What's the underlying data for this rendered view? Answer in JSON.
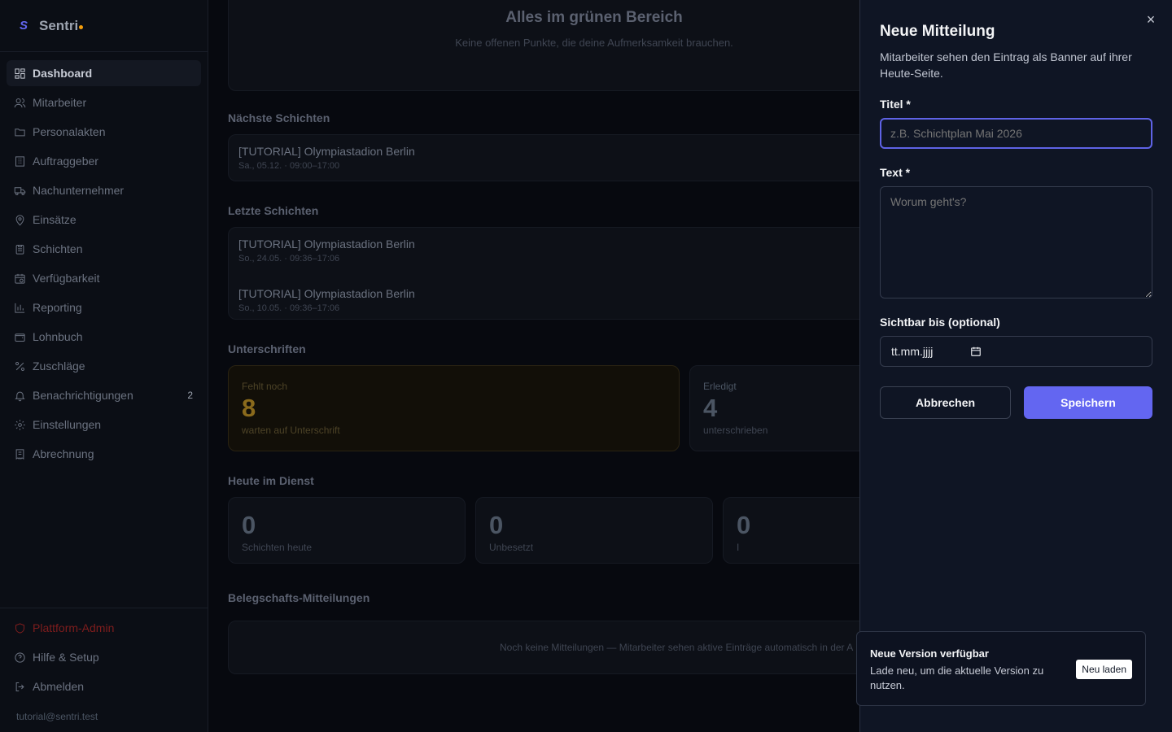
{
  "app": {
    "name": "Sentri",
    "logo_letter": "S"
  },
  "sidebar": {
    "items": [
      {
        "label": "Dashboard",
        "icon": "grid-icon"
      },
      {
        "label": "Mitarbeiter",
        "icon": "users-icon"
      },
      {
        "label": "Personalakten",
        "icon": "folder-icon"
      },
      {
        "label": "Auftraggeber",
        "icon": "building-icon"
      },
      {
        "label": "Nachunternehmer",
        "icon": "truck-icon"
      },
      {
        "label": "Einsätze",
        "icon": "map-pin-icon"
      },
      {
        "label": "Schichten",
        "icon": "clipboard-icon"
      },
      {
        "label": "Verfügbarkeit",
        "icon": "calendar-clock-icon"
      },
      {
        "label": "Reporting",
        "icon": "bar-chart-icon"
      },
      {
        "label": "Lohnbuch",
        "icon": "wallet-icon"
      },
      {
        "label": "Zuschläge",
        "icon": "percent-icon"
      },
      {
        "label": "Benachrichtigungen",
        "icon": "bell-icon",
        "badge": "2"
      },
      {
        "label": "Einstellungen",
        "icon": "gear-icon"
      },
      {
        "label": "Abrechnung",
        "icon": "receipt-icon"
      }
    ],
    "bottom": [
      {
        "label": "Plattform-Admin",
        "icon": "shield-icon"
      },
      {
        "label": "Hilfe & Setup",
        "icon": "help-circle-icon"
      },
      {
        "label": "Abmelden",
        "icon": "logout-icon"
      }
    ],
    "user_email": "tutorial@sentri.test"
  },
  "main": {
    "ok_title": "Alles im grünen Bereich",
    "ok_subtitle": "Keine offenen Punkte, die deine Aufmerksamkeit brauchen.",
    "next_shifts": {
      "title": "Nächste Schichten",
      "items": [
        {
          "name": "[TUTORIAL] Olympiastadion Berlin",
          "time": "Sa., 05.12. · 09:00–17:00"
        }
      ]
    },
    "last_shifts": {
      "title": "Letzte Schichten",
      "items": [
        {
          "name": "[TUTORIAL] Olympiastadion Berlin",
          "time": "So., 24.05. · 09:36–17:06"
        },
        {
          "name": "[TUTORIAL] Olympiastadion Berlin",
          "time": "So., 10.05. · 09:36–17:06"
        }
      ]
    },
    "signatures": {
      "title": "Unterschriften",
      "missing": {
        "label": "Fehlt noch",
        "value": "8",
        "sub": "warten auf Unterschrift"
      },
      "done": {
        "label": "Erledigt",
        "value": "4",
        "sub": "unterschrieben"
      }
    },
    "today": {
      "title": "Heute im Dienst",
      "stats": [
        {
          "value": "0",
          "sub": "Schichten heute"
        },
        {
          "value": "0",
          "sub": "Unbesetzt"
        },
        {
          "value": "0",
          "sub": "I"
        }
      ]
    },
    "announcements": {
      "title": "Belegschafts-Mitteilungen",
      "empty": "Noch keine Mitteilungen — Mitarbeiter sehen aktive Einträge automatisch in der A"
    }
  },
  "drawer": {
    "title": "Neue Mitteilung",
    "description": "Mitarbeiter sehen den Eintrag als Banner auf ihrer Heute-Seite.",
    "title_label": "Titel *",
    "title_placeholder": "z.B. Schichtplan Mai 2026",
    "text_label": "Text *",
    "text_placeholder": "Worum geht's?",
    "visible_label": "Sichtbar bis (optional)",
    "date_placeholder": "tt.mm.jjjj",
    "cancel": "Abbrechen",
    "save": "Speichern",
    "close": "×"
  },
  "toast": {
    "title": "Neue Version verfügbar",
    "description": "Lade neu, um die aktuelle Version zu nutzen.",
    "button": "Neu laden"
  },
  "colors": {
    "accent": "#6366f1",
    "warning": "#8a6a1c",
    "danger": "#7f1d1d"
  }
}
